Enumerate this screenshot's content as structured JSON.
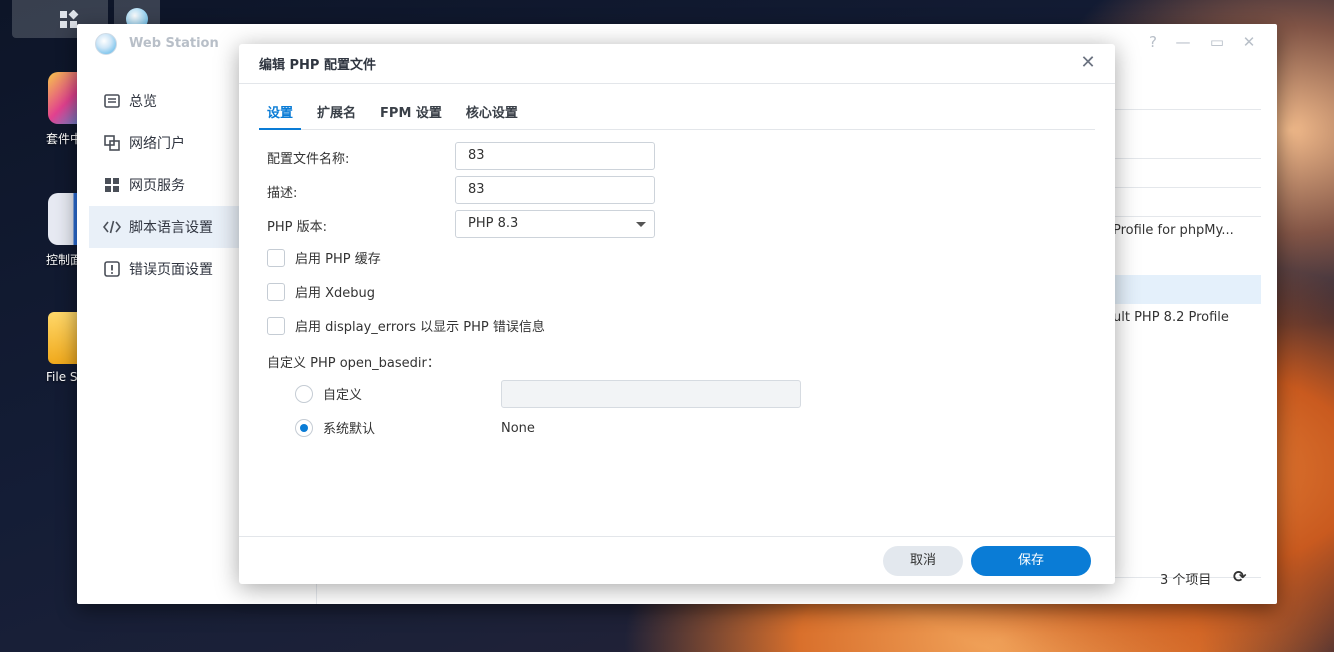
{
  "desktop": {
    "icons": [
      {
        "label": "套件中"
      },
      {
        "label": "控制面"
      },
      {
        "label": "File Sta"
      }
    ]
  },
  "window": {
    "title": "Web Station",
    "controls": {
      "help": "?",
      "minimize": "—",
      "maximize": "▭",
      "close": "✕"
    },
    "sidebar": {
      "items": [
        {
          "label": "总览",
          "icon": "overview-icon"
        },
        {
          "label": "网络门户",
          "icon": "portal-icon"
        },
        {
          "label": "网页服务",
          "icon": "services-icon"
        },
        {
          "label": "脚本语言设置",
          "icon": "code-icon"
        },
        {
          "label": "错误页面设置",
          "icon": "error-page-icon"
        }
      ],
      "active_index": 3
    },
    "list": {
      "row1_text": "Profile for phpMy...",
      "row3_text": "ult PHP 8.2 Profile",
      "count_text": "3 个项目"
    }
  },
  "modal": {
    "title": "编辑 PHP 配置文件",
    "tabs": [
      "设置",
      "扩展名",
      "FPM 设置",
      "核心设置"
    ],
    "active_tab": 0,
    "form": {
      "profile_name_label": "配置文件名称:",
      "profile_name_value": "83",
      "description_label": "描述:",
      "description_value": "83",
      "php_version_label": "PHP 版本:",
      "php_version_value": "PHP 8.3",
      "enable_cache_label": "启用 PHP 缓存",
      "enable_xdebug_label": "启用 Xdebug",
      "enable_display_errors_label": "启用 display_errors 以显示 PHP 错误信息",
      "open_basedir_label": "自定义 PHP open_basedir：",
      "custom_label": "自定义",
      "system_default_label": "系统默认",
      "system_default_value": "None"
    },
    "buttons": {
      "cancel": "取消",
      "save": "保存"
    }
  },
  "colors": {
    "accent": "#0a7cd6",
    "selection": "#e9f0f8"
  }
}
